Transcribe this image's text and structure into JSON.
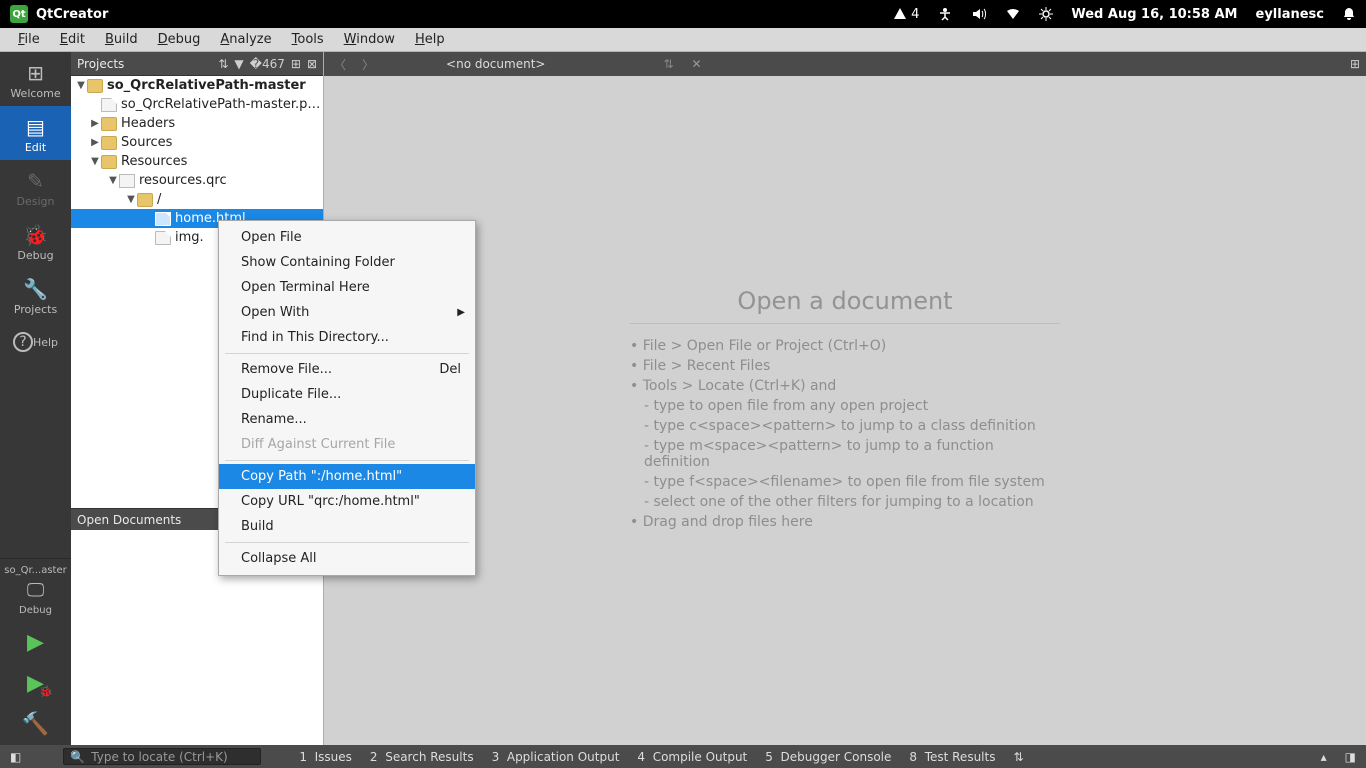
{
  "desktop": {
    "app_title": "QtCreator",
    "net_count": "4",
    "datetime": "Wed Aug 16, 10:58 AM",
    "user": "eyllanesc"
  },
  "menubar": [
    "File",
    "Edit",
    "Build",
    "Debug",
    "Analyze",
    "Tools",
    "Window",
    "Help"
  ],
  "leftbar": {
    "modes": [
      {
        "label": "Welcome",
        "icon": "⊞"
      },
      {
        "label": "Edit",
        "icon": "▤"
      },
      {
        "label": "Design",
        "icon": "✎"
      },
      {
        "label": "Debug",
        "icon": "🐞"
      },
      {
        "label": "Projects",
        "icon": "🔧"
      },
      {
        "label": "Help",
        "icon": "?"
      }
    ],
    "kit_project": "so_Qr...aster",
    "kit_config": "Debug"
  },
  "projects_panel": {
    "title": "Projects",
    "tree": {
      "root": "so_QrcRelativePath-master",
      "pro": "so_QrcRelativePath-master.p…",
      "headers": "Headers",
      "sources": "Sources",
      "resources": "Resources",
      "qrc": "resources.qrc",
      "prefix": "/",
      "home": "home.html",
      "img": "img."
    }
  },
  "open_docs": {
    "title": "Open Documents"
  },
  "editor": {
    "no_doc": "<no document>",
    "welcome_title": "Open a document",
    "hints": [
      "File > Open File or Project (Ctrl+O)",
      "File > Recent Files",
      "Tools > Locate (Ctrl+K) and"
    ],
    "subhints": [
      "type to open file from any open project",
      "type c<space><pattern> to jump to a class definition",
      "type m<space><pattern> to jump to a function definition",
      "type f<space><filename> to open file from file system",
      "select one of the other filters for jumping to a location"
    ],
    "drag": "Drag and drop files here"
  },
  "context_menu": {
    "items": [
      {
        "label": "Open File"
      },
      {
        "label": "Show Containing Folder"
      },
      {
        "label": "Open Terminal Here"
      },
      {
        "label": "Open With",
        "submenu": true
      },
      {
        "label": "Find in This Directory..."
      },
      {
        "sep": true
      },
      {
        "label": "Remove File...",
        "shortcut": "Del"
      },
      {
        "label": "Duplicate File..."
      },
      {
        "label": "Rename..."
      },
      {
        "label": "Diff Against Current File",
        "disabled": true
      },
      {
        "sep": true
      },
      {
        "label": "Copy Path \":/home.html\"",
        "hl": true
      },
      {
        "label": "Copy URL \"qrc:/home.html\""
      },
      {
        "label": "Build"
      },
      {
        "sep": true
      },
      {
        "label": "Collapse All"
      }
    ]
  },
  "statusbar": {
    "locator_placeholder": "Type to locate (Ctrl+K)",
    "panes": [
      {
        "n": "1",
        "label": "Issues"
      },
      {
        "n": "2",
        "label": "Search Results"
      },
      {
        "n": "3",
        "label": "Application Output"
      },
      {
        "n": "4",
        "label": "Compile Output"
      },
      {
        "n": "5",
        "label": "Debugger Console"
      },
      {
        "n": "8",
        "label": "Test Results"
      }
    ]
  }
}
